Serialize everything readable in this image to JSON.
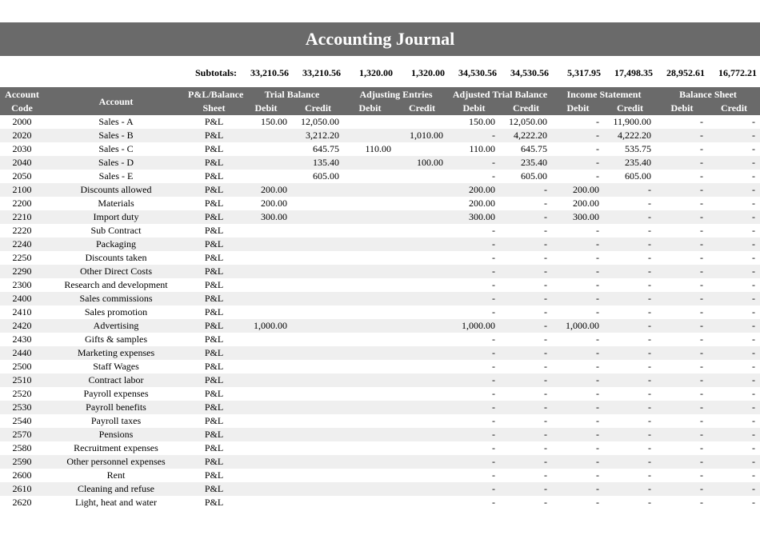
{
  "title": "Accounting Journal",
  "subtotals": {
    "label": "Subtotals:",
    "values": [
      "33,210.56",
      "33,210.56",
      "1,320.00",
      "1,320.00",
      "34,530.56",
      "34,530.56",
      "5,317.95",
      "17,498.35",
      "28,952.61",
      "16,772.21"
    ]
  },
  "header": {
    "account_code_top": "Account",
    "account_code_bot": "Code",
    "account": "Account",
    "plb_top": "P&L/Balance",
    "plb_bot": "Sheet",
    "groups": [
      "Trial Balance",
      "Adjusting Entries",
      "Adjusted Trial Balance",
      "Income Statement",
      "Balance Sheet"
    ],
    "debit": "Debit",
    "credit": "Credit"
  },
  "rows": [
    {
      "code": "2000",
      "acct": "Sales - A",
      "plb": "P&L",
      "tb_d": "150.00",
      "tb_c": "12,050.00",
      "ae_d": "",
      "ae_c": "",
      "atb_d": "150.00",
      "atb_c": "12,050.00",
      "is_d": "-",
      "is_c": "11,900.00",
      "bs_d": "-",
      "bs_c": "-"
    },
    {
      "code": "2020",
      "acct": "Sales - B",
      "plb": "P&L",
      "tb_d": "",
      "tb_c": "3,212.20",
      "ae_d": "",
      "ae_c": "1,010.00",
      "atb_d": "-",
      "atb_c": "4,222.20",
      "is_d": "-",
      "is_c": "4,222.20",
      "bs_d": "-",
      "bs_c": "-"
    },
    {
      "code": "2030",
      "acct": "Sales - C",
      "plb": "P&L",
      "tb_d": "",
      "tb_c": "645.75",
      "ae_d": "110.00",
      "ae_c": "",
      "atb_d": "110.00",
      "atb_c": "645.75",
      "is_d": "-",
      "is_c": "535.75",
      "bs_d": "-",
      "bs_c": "-"
    },
    {
      "code": "2040",
      "acct": "Sales - D",
      "plb": "P&L",
      "tb_d": "",
      "tb_c": "135.40",
      "ae_d": "",
      "ae_c": "100.00",
      "atb_d": "-",
      "atb_c": "235.40",
      "is_d": "-",
      "is_c": "235.40",
      "bs_d": "-",
      "bs_c": "-"
    },
    {
      "code": "2050",
      "acct": "Sales - E",
      "plb": "P&L",
      "tb_d": "",
      "tb_c": "605.00",
      "ae_d": "",
      "ae_c": "",
      "atb_d": "-",
      "atb_c": "605.00",
      "is_d": "-",
      "is_c": "605.00",
      "bs_d": "-",
      "bs_c": "-"
    },
    {
      "code": "2100",
      "acct": "Discounts allowed",
      "plb": "P&L",
      "tb_d": "200.00",
      "tb_c": "",
      "ae_d": "",
      "ae_c": "",
      "atb_d": "200.00",
      "atb_c": "-",
      "is_d": "200.00",
      "is_c": "-",
      "bs_d": "-",
      "bs_c": "-"
    },
    {
      "code": "2200",
      "acct": "Materials",
      "plb": "P&L",
      "tb_d": "200.00",
      "tb_c": "",
      "ae_d": "",
      "ae_c": "",
      "atb_d": "200.00",
      "atb_c": "-",
      "is_d": "200.00",
      "is_c": "-",
      "bs_d": "-",
      "bs_c": "-"
    },
    {
      "code": "2210",
      "acct": "Import duty",
      "plb": "P&L",
      "tb_d": "300.00",
      "tb_c": "",
      "ae_d": "",
      "ae_c": "",
      "atb_d": "300.00",
      "atb_c": "-",
      "is_d": "300.00",
      "is_c": "-",
      "bs_d": "-",
      "bs_c": "-"
    },
    {
      "code": "2220",
      "acct": "Sub Contract",
      "plb": "P&L",
      "tb_d": "",
      "tb_c": "",
      "ae_d": "",
      "ae_c": "",
      "atb_d": "-",
      "atb_c": "-",
      "is_d": "-",
      "is_c": "-",
      "bs_d": "-",
      "bs_c": "-"
    },
    {
      "code": "2240",
      "acct": "Packaging",
      "plb": "P&L",
      "tb_d": "",
      "tb_c": "",
      "ae_d": "",
      "ae_c": "",
      "atb_d": "-",
      "atb_c": "-",
      "is_d": "-",
      "is_c": "-",
      "bs_d": "-",
      "bs_c": "-"
    },
    {
      "code": "2250",
      "acct": "Discounts taken",
      "plb": "P&L",
      "tb_d": "",
      "tb_c": "",
      "ae_d": "",
      "ae_c": "",
      "atb_d": "-",
      "atb_c": "-",
      "is_d": "-",
      "is_c": "-",
      "bs_d": "-",
      "bs_c": "-"
    },
    {
      "code": "2290",
      "acct": "Other Direct Costs",
      "plb": "P&L",
      "tb_d": "",
      "tb_c": "",
      "ae_d": "",
      "ae_c": "",
      "atb_d": "-",
      "atb_c": "-",
      "is_d": "-",
      "is_c": "-",
      "bs_d": "-",
      "bs_c": "-"
    },
    {
      "code": "2300",
      "acct": "Research and development",
      "plb": "P&L",
      "tb_d": "",
      "tb_c": "",
      "ae_d": "",
      "ae_c": "",
      "atb_d": "-",
      "atb_c": "-",
      "is_d": "-",
      "is_c": "-",
      "bs_d": "-",
      "bs_c": "-"
    },
    {
      "code": "2400",
      "acct": "Sales commissions",
      "plb": "P&L",
      "tb_d": "",
      "tb_c": "",
      "ae_d": "",
      "ae_c": "",
      "atb_d": "-",
      "atb_c": "-",
      "is_d": "-",
      "is_c": "-",
      "bs_d": "-",
      "bs_c": "-"
    },
    {
      "code": "2410",
      "acct": "Sales promotion",
      "plb": "P&L",
      "tb_d": "",
      "tb_c": "",
      "ae_d": "",
      "ae_c": "",
      "atb_d": "-",
      "atb_c": "-",
      "is_d": "-",
      "is_c": "-",
      "bs_d": "-",
      "bs_c": "-"
    },
    {
      "code": "2420",
      "acct": "Advertising",
      "plb": "P&L",
      "tb_d": "1,000.00",
      "tb_c": "",
      "ae_d": "",
      "ae_c": "",
      "atb_d": "1,000.00",
      "atb_c": "-",
      "is_d": "1,000.00",
      "is_c": "-",
      "bs_d": "-",
      "bs_c": "-"
    },
    {
      "code": "2430",
      "acct": "Gifts & samples",
      "plb": "P&L",
      "tb_d": "",
      "tb_c": "",
      "ae_d": "",
      "ae_c": "",
      "atb_d": "-",
      "atb_c": "-",
      "is_d": "-",
      "is_c": "-",
      "bs_d": "-",
      "bs_c": "-"
    },
    {
      "code": "2440",
      "acct": "Marketing expenses",
      "plb": "P&L",
      "tb_d": "",
      "tb_c": "",
      "ae_d": "",
      "ae_c": "",
      "atb_d": "-",
      "atb_c": "-",
      "is_d": "-",
      "is_c": "-",
      "bs_d": "-",
      "bs_c": "-"
    },
    {
      "code": "2500",
      "acct": "Staff Wages",
      "plb": "P&L",
      "tb_d": "",
      "tb_c": "",
      "ae_d": "",
      "ae_c": "",
      "atb_d": "-",
      "atb_c": "-",
      "is_d": "-",
      "is_c": "-",
      "bs_d": "-",
      "bs_c": "-"
    },
    {
      "code": "2510",
      "acct": "Contract labor",
      "plb": "P&L",
      "tb_d": "",
      "tb_c": "",
      "ae_d": "",
      "ae_c": "",
      "atb_d": "-",
      "atb_c": "-",
      "is_d": "-",
      "is_c": "-",
      "bs_d": "-",
      "bs_c": "-"
    },
    {
      "code": "2520",
      "acct": "Payroll expenses",
      "plb": "P&L",
      "tb_d": "",
      "tb_c": "",
      "ae_d": "",
      "ae_c": "",
      "atb_d": "-",
      "atb_c": "-",
      "is_d": "-",
      "is_c": "-",
      "bs_d": "-",
      "bs_c": "-"
    },
    {
      "code": "2530",
      "acct": "Payroll benefits",
      "plb": "P&L",
      "tb_d": "",
      "tb_c": "",
      "ae_d": "",
      "ae_c": "",
      "atb_d": "-",
      "atb_c": "-",
      "is_d": "-",
      "is_c": "-",
      "bs_d": "-",
      "bs_c": "-"
    },
    {
      "code": "2540",
      "acct": "Payroll taxes",
      "plb": "P&L",
      "tb_d": "",
      "tb_c": "",
      "ae_d": "",
      "ae_c": "",
      "atb_d": "-",
      "atb_c": "-",
      "is_d": "-",
      "is_c": "-",
      "bs_d": "-",
      "bs_c": "-"
    },
    {
      "code": "2570",
      "acct": "Pensions",
      "plb": "P&L",
      "tb_d": "",
      "tb_c": "",
      "ae_d": "",
      "ae_c": "",
      "atb_d": "-",
      "atb_c": "-",
      "is_d": "-",
      "is_c": "-",
      "bs_d": "-",
      "bs_c": "-"
    },
    {
      "code": "2580",
      "acct": "Recruitment expenses",
      "plb": "P&L",
      "tb_d": "",
      "tb_c": "",
      "ae_d": "",
      "ae_c": "",
      "atb_d": "-",
      "atb_c": "-",
      "is_d": "-",
      "is_c": "-",
      "bs_d": "-",
      "bs_c": "-"
    },
    {
      "code": "2590",
      "acct": "Other personnel expenses",
      "plb": "P&L",
      "tb_d": "",
      "tb_c": "",
      "ae_d": "",
      "ae_c": "",
      "atb_d": "-",
      "atb_c": "-",
      "is_d": "-",
      "is_c": "-",
      "bs_d": "-",
      "bs_c": "-"
    },
    {
      "code": "2600",
      "acct": "Rent",
      "plb": "P&L",
      "tb_d": "",
      "tb_c": "",
      "ae_d": "",
      "ae_c": "",
      "atb_d": "-",
      "atb_c": "-",
      "is_d": "-",
      "is_c": "-",
      "bs_d": "-",
      "bs_c": "-"
    },
    {
      "code": "2610",
      "acct": "Cleaning and refuse",
      "plb": "P&L",
      "tb_d": "",
      "tb_c": "",
      "ae_d": "",
      "ae_c": "",
      "atb_d": "-",
      "atb_c": "-",
      "is_d": "-",
      "is_c": "-",
      "bs_d": "-",
      "bs_c": "-"
    },
    {
      "code": "2620",
      "acct": "Light, heat and water",
      "plb": "P&L",
      "tb_d": "",
      "tb_c": "",
      "ae_d": "",
      "ae_c": "",
      "atb_d": "-",
      "atb_c": "-",
      "is_d": "-",
      "is_c": "-",
      "bs_d": "-",
      "bs_c": "-"
    }
  ]
}
